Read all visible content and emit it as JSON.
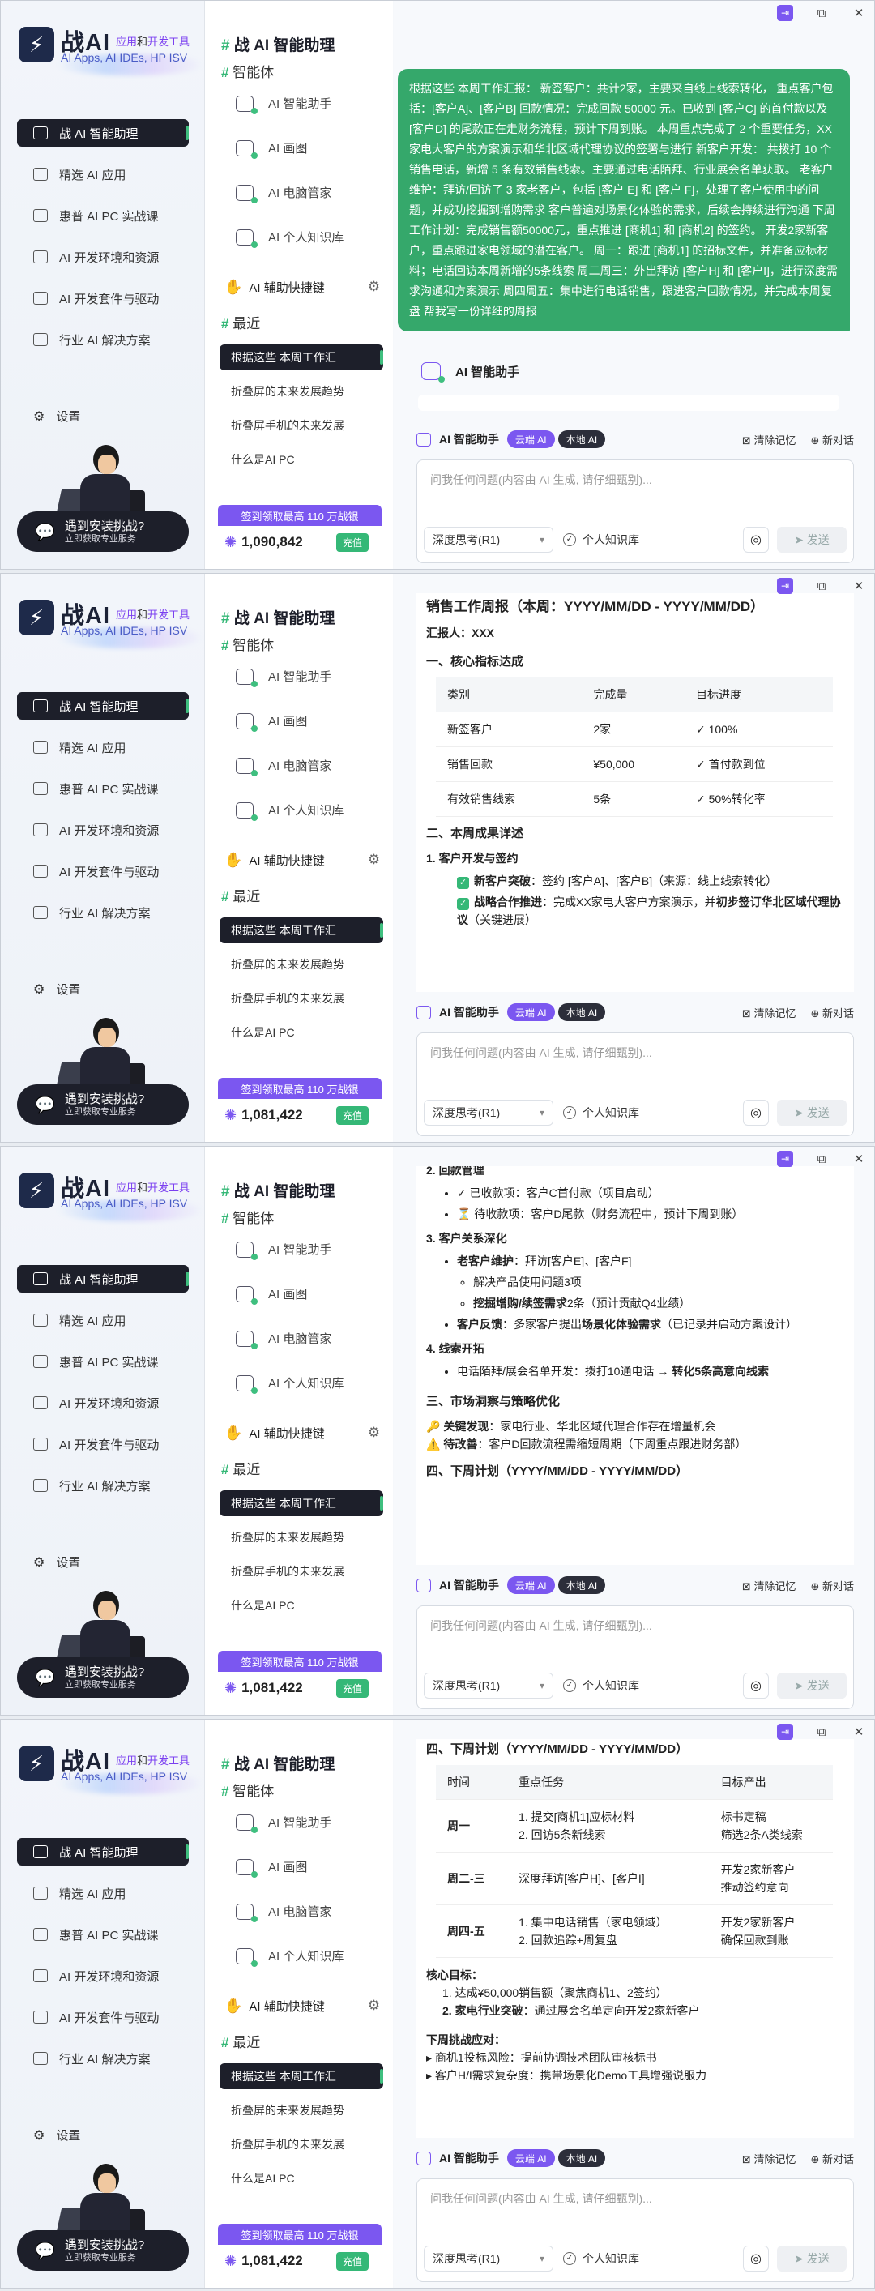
{
  "app": {
    "logo_text": "战AI",
    "logo_sub_a": "应用",
    "logo_sub_b": "和",
    "logo_sub_c": "开发工具",
    "logo_line2": "AI Apps, AI IDEs, HP ISV"
  },
  "window_controls": [
    "pin-icon",
    "restore-icon",
    "close-icon"
  ],
  "sidebar": {
    "items": [
      {
        "label": "战 AI 智能助理",
        "icon": "chat-icon",
        "active": true
      },
      {
        "label": "精选 AI 应用",
        "icon": "apps-icon"
      },
      {
        "label": "惠普 AI PC 实战课",
        "icon": "course-icon"
      },
      {
        "label": "AI 开发环境和资源",
        "icon": "flask-icon"
      },
      {
        "label": "AI 开发套件与驱动",
        "icon": "code-icon"
      },
      {
        "label": "行业 AI 解决方案",
        "icon": "industry-icon"
      }
    ],
    "settings_label": "设置",
    "promo_title": "遇到安装挑战?",
    "promo_sub": "立即获取专业服务"
  },
  "col2": {
    "title": "战 AI 智能助理",
    "agents_header": "智能体",
    "agents": [
      "AI 智能助手",
      "AI 画图",
      "AI 电脑管家",
      "AI 个人知识库"
    ],
    "helper_label": "AI 辅助快捷键",
    "recent_header": "最近",
    "recent": [
      "根据这些 本周工作汇",
      "折叠屏的未来发展趋势",
      "折叠屏手机的未来发展",
      "什么是AI PC"
    ],
    "points_banner": "签到领取最高 110 万战银",
    "recharge": "充值"
  },
  "points": [
    "1,090,842",
    "1,081,422",
    "1,081,422",
    "1,081,422"
  ],
  "chat": {
    "user_message": "根据这些 本周工作汇报： 新签客户：共计2家，主要来自线上线索转化， 重点客户包括：[客户A]、[客户B] 回款情况：完成回款 50000 元。已收到 [客户C] 的首付款以及 [客户D] 的尾款正在走财务流程，预计下周到账。 本周重点完成了 2 个重要任务，XX家电大客户的方案演示和华北区域代理协议的签署与进行 新客户开发： 共拨打 10 个销售电话，新增 5 条有效销售线索。主要通过电话陌拜、行业展会名单获取。 老客户维护：拜访/回访了 3 家老客户，包括 [客户 E] 和 [客户 F]，处理了客户使用中的问题，并成功挖掘到增购需求 客户普遍对场景化体验的需求，后续会持续进行沟通 下周工作计划：完成销售额50000元，重点推进 [商机1] 和 [商机2] 的签约。 开发2家新客户，重点跟进家电领域的潜在客户。 周一：跟进 [商机1] 的招标文件，并准备应标材料；电话回访本周新增的5条线索 周二周三：外出拜访 [客户H] 和 [客户I]，进行深度需求沟通和方案演示 周四周五：集中进行电话销售，跟进客户回款情况，并完成本周复盘 帮我写一份详细的周报",
    "assistant_name": "AI 智能助手"
  },
  "input": {
    "agent_name": "AI 智能助手",
    "cloud_pill": "云端 AI",
    "local_pill": "本地 AI",
    "clear_label": "清除记忆",
    "new_label": "新对话",
    "placeholder": "问我任何问题(内容由 AI 生成, 请仔细甄别)...",
    "mode": "深度思考(R1)",
    "kb_label": "个人知识库",
    "send_label": "发送"
  },
  "report2": {
    "title": "销售工作周报（本周：YYYY/MM/DD - YYYY/MM/DD）",
    "reporter": "汇报人：XXX",
    "sec1": "一、核心指标达成",
    "table_head": [
      "类别",
      "完成量",
      "目标进度"
    ],
    "table_rows": [
      [
        "新签客户",
        "2家",
        "✓ 100%"
      ],
      [
        "销售回款",
        "¥50,000",
        "✓ 首付款到位"
      ],
      [
        "有效销售线索",
        "5条",
        "✓ 50%转化率"
      ]
    ],
    "sec2": "二、本周成果详述",
    "sub1": "1. 客户开发与签约",
    "b1_label": "新客户突破",
    "b1_text": "：签约 [客户A]、[客户B]（来源：线上线索转化）",
    "b2_label": "战略合作推进",
    "b2_text": "：完成XX家电大客户方案演示，并",
    "b2_bold": "初步签订华北区域代理协议",
    "b2_tail": "（关键进展）"
  },
  "report3": {
    "sub2": "2. 回款管理",
    "r1": "✓ 已收款项：客户C首付款（项目启动）",
    "r2": "⏳ 待收款项：客户D尾款（财务流程中，预计下周到账）",
    "sub3": "3. 客户关系深化",
    "c1_label": "老客户维护",
    "c1_text": "：拜访[客户E]、[客户F]",
    "c1a": "解决产品使用问题3项",
    "c1b_label": "挖掘增购/续签需求",
    "c1b_text": "2条（预计贡献Q4业绩）",
    "c2_label": "客户反馈",
    "c2_text": "：多家客户提出",
    "c2_bold": "场景化体验需求",
    "c2_tail": "（已记录并启动方案设计）",
    "sub4": "4. 线索开拓",
    "l1": "电话陌拜/展会名单开发：拨打10通电话 → ",
    "l1_bold": "转化5条高意向线索",
    "sec3": "三、市场洞察与策略优化",
    "m1_label": "关键发现",
    "m1_text": "：家电行业、华北区域代理合作存在增量机会",
    "m2_label": "待改善",
    "m2_text": "：客户D回款流程需缩短周期（下周重点跟进财务部）",
    "sec4_cut": "四、下周计划（YYYY/MM/DD - YYYY/MM/DD）"
  },
  "report4": {
    "sec4": "四、下周计划（YYYY/MM/DD - YYYY/MM/DD）",
    "head": [
      "时间",
      "重点任务",
      "目标产出"
    ],
    "rows": [
      {
        "time": "周一",
        "tasks": [
          "1. 提交[商机1]应标材料",
          "2. 回访5条新线索"
        ],
        "out": [
          "标书定稿",
          "筛选2条A类线索"
        ]
      },
      {
        "time": "周二-三",
        "tasks": [
          "深度拜访[客户H]、[客户I]"
        ],
        "out": [
          "开发2家新客户",
          "推动签约意向"
        ]
      },
      {
        "time": "周四-五",
        "tasks": [
          "1. 集中电话销售（家电领域）",
          "2. 回款追踪+周复盘"
        ],
        "out": [
          "开发2家新客户",
          "确保回款到账"
        ]
      }
    ],
    "goal_title": "核心目标：",
    "g1": "1. 达成¥50,000销售额（聚焦商机1、2签约）",
    "g2_label": "2. 家电行业突破",
    "g2_text": "：通过展会名单定向开发2家新客户",
    "risk_title": "下周挑战应对：",
    "k1": "▸ 商机1投标风险：提前协调技术团队审核标书",
    "k2": "▸ 客户H/I需求复杂度：携带场景化Demo工具增强说服力"
  }
}
